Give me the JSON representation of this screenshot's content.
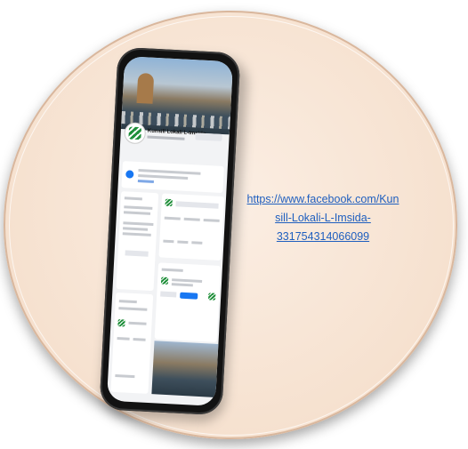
{
  "link": {
    "line1": "https://www.facebook.com/Kun",
    "line2": "sill-Lokali-L-Imsida-",
    "line3": "331754314066099"
  },
  "phone": {
    "page_name": "Kunsill Lokali L-Imsida"
  },
  "colors": {
    "circle": "#f6e1cf",
    "link": "#1f5fbf",
    "facebook_blue": "#1877f2",
    "logo_green": "#1f8f3a"
  }
}
